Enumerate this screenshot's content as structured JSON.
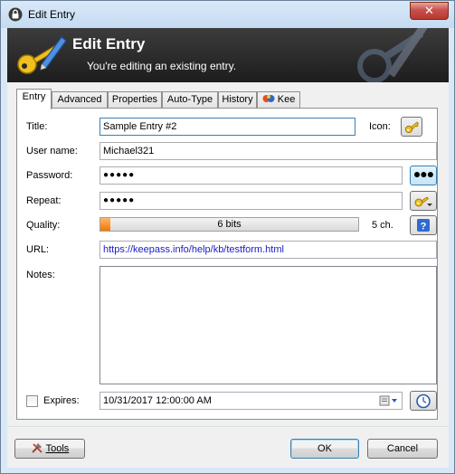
{
  "window": {
    "title": "Edit Entry",
    "close_glyph": "✕"
  },
  "banner": {
    "title": "Edit Entry",
    "subtitle": "You're editing an existing entry."
  },
  "tabs": [
    {
      "label": "Entry",
      "active": true
    },
    {
      "label": "Advanced",
      "active": false
    },
    {
      "label": "Properties",
      "active": false
    },
    {
      "label": "Auto-Type",
      "active": false
    },
    {
      "label": "History",
      "active": false
    },
    {
      "label": "Kee",
      "active": false,
      "icon": "kee-icon"
    }
  ],
  "entry": {
    "title_label": "Title:",
    "title_value": "Sample Entry #2",
    "icon_label": "Icon:",
    "icon_name": "key-icon",
    "username_label": "User name:",
    "username_value": "Michael321",
    "password_label": "Password:",
    "password_value": "●●●●●",
    "password_toggle_glyph": "●●●",
    "repeat_label": "Repeat:",
    "repeat_value": "●●●●●",
    "generator_icon": "password-generator-icon",
    "quality_label": "Quality:",
    "quality_text": "6 bits",
    "quality_fraction": 0.04,
    "quality_chars": "5 ch.",
    "quality_help_icon": "help-icon",
    "url_label": "URL:",
    "url_value": "https://keepass.info/help/kb/testform.html",
    "notes_label": "Notes:",
    "notes_value": "",
    "expires_label": "Expires:",
    "expires_checked": false,
    "expires_value": "10/31/2017 12:00:00 AM",
    "expiry_presets_icon": "clock-icon"
  },
  "footer": {
    "tools_label": "Tools",
    "ok_label": "OK",
    "cancel_label": "Cancel"
  },
  "colors": {
    "quality_fill": "#f07a00",
    "banner_bg": "#2a2a2a",
    "url_text": "#1a1ac8"
  }
}
